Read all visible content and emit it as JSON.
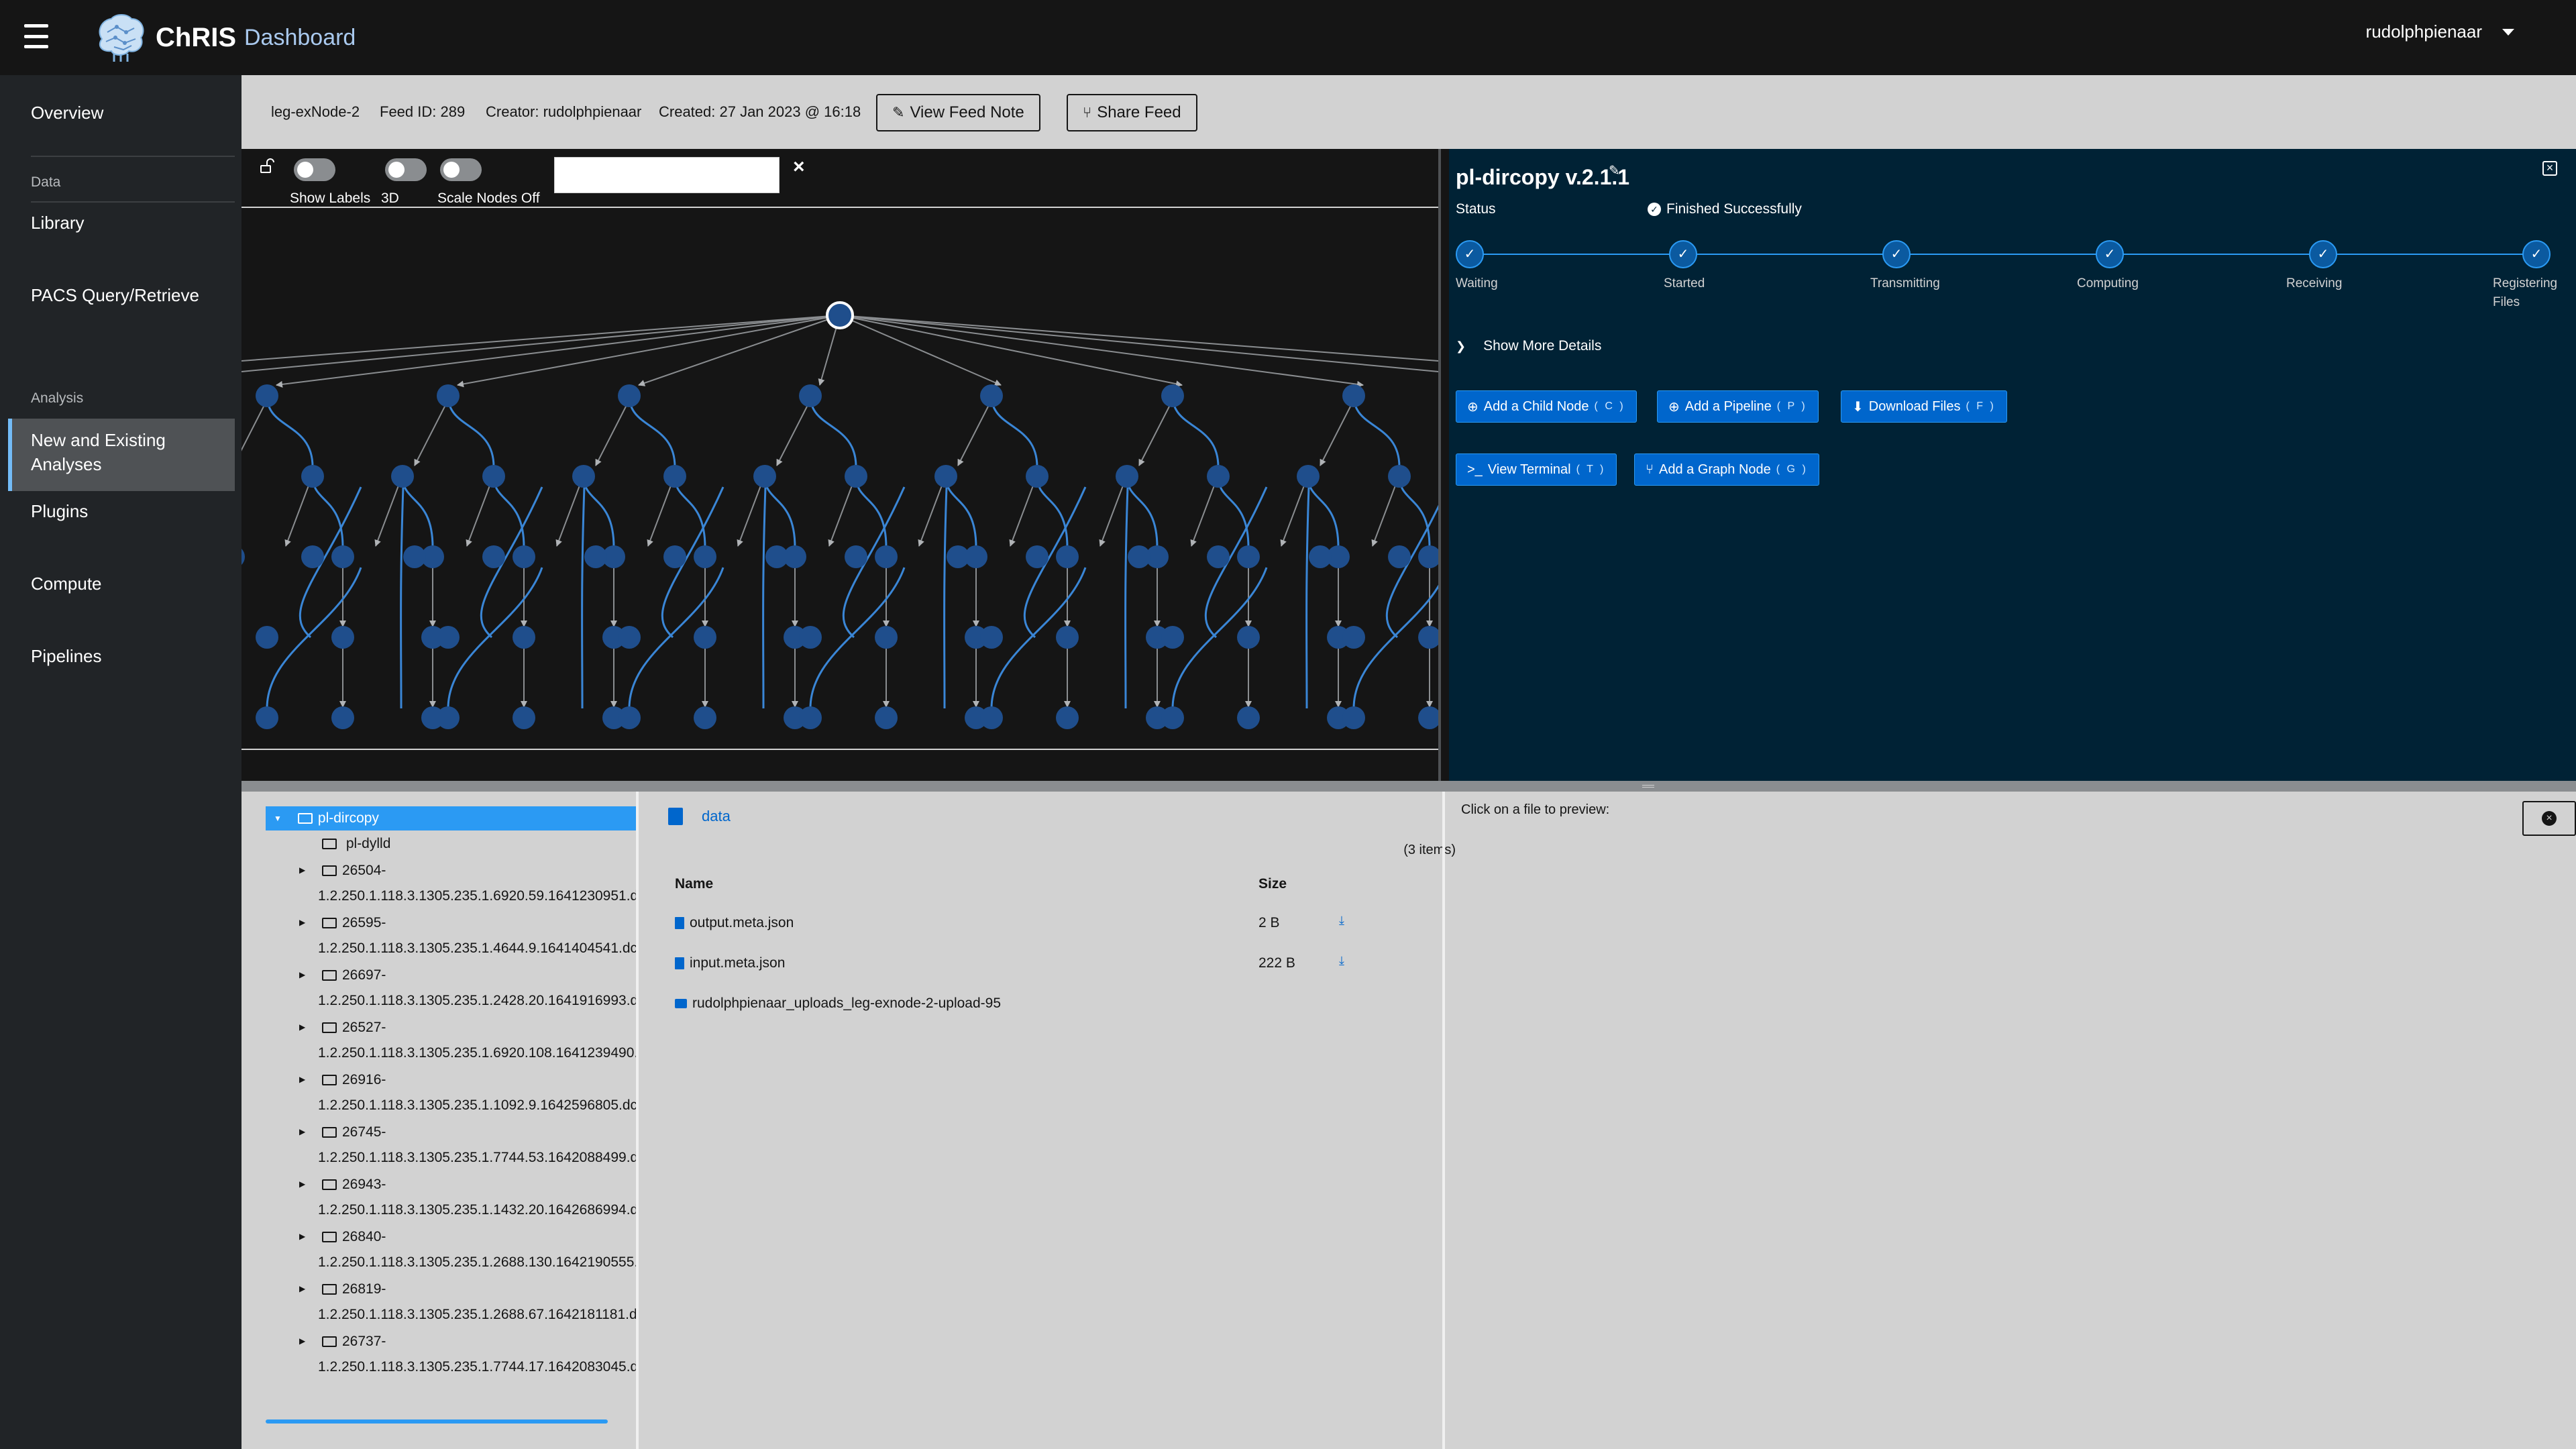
{
  "header": {
    "brand": "ChRIS",
    "product": "Dashboard",
    "username": "rudolphpienaar"
  },
  "sidebar": {
    "overview": "Overview",
    "data_section": "Data",
    "library": "Library",
    "pacs": "PACS Query/Retrieve",
    "analysis_section": "Analysis",
    "analyses_line1": "New and Existing",
    "analyses_line2": "Analyses",
    "plugins": "Plugins",
    "compute": "Compute",
    "pipelines": "Pipelines"
  },
  "feed": {
    "name": "leg-exNode-2",
    "feed_id": "Feed ID: 289",
    "creator": "Creator: rudolphpienaar",
    "created": "Created: 27 Jan 2023 @ 16:18",
    "view_note": "View Feed Note",
    "share": "Share Feed"
  },
  "graph": {
    "show_labels": "Show Labels",
    "three_d": "3D",
    "scale_nodes": "Scale Nodes Off",
    "search_value": "",
    "clear": "×",
    "node_color": "#1f4e8c",
    "edge_color": "#8a8d90",
    "curve_color": "#3a86d6"
  },
  "node_details": {
    "title": "pl-dircopy v.2.1.1",
    "status_label": "Status",
    "status_value": "Finished Successfully",
    "steps": [
      "Waiting",
      "Started",
      "Transmitting",
      "Computing",
      "Receiving",
      "Registering"
    ],
    "last_step_line2": "Files",
    "show_more": "Show More Details",
    "btn_add_child": "Add a Child Node",
    "btn_add_child_key": "( C )",
    "btn_add_pipeline": "Add a Pipeline",
    "btn_add_pipeline_key": "( P )",
    "btn_download": "Download Files",
    "btn_download_key": "( F )",
    "btn_terminal": "View Terminal",
    "btn_terminal_key": "( T )",
    "btn_graph_node": "Add a Graph Node",
    "btn_graph_node_key": "( G )"
  },
  "tree": {
    "root": "pl-dircopy",
    "child_plain": "pl-dylld",
    "items": [
      {
        "id": "26504-",
        "path": "1.2.250.1.118.3.1305.235.1.6920.59.1641230951.d"
      },
      {
        "id": "26595-",
        "path": "1.2.250.1.118.3.1305.235.1.4644.9.1641404541.dc"
      },
      {
        "id": "26697-",
        "path": "1.2.250.1.118.3.1305.235.1.2428.20.1641916993.d"
      },
      {
        "id": "26527-",
        "path": "1.2.250.1.118.3.1305.235.1.6920.108.1641239490."
      },
      {
        "id": "26916-",
        "path": "1.2.250.1.118.3.1305.235.1.1092.9.1642596805.dc"
      },
      {
        "id": "26745-",
        "path": "1.2.250.1.118.3.1305.235.1.7744.53.1642088499.d"
      },
      {
        "id": "26943-",
        "path": "1.2.250.1.118.3.1305.235.1.1432.20.1642686994.d"
      },
      {
        "id": "26840-",
        "path": "1.2.250.1.118.3.1305.235.1.2688.130.1642190555."
      },
      {
        "id": "26819-",
        "path": "1.2.250.1.118.3.1305.235.1.2688.67.1642181181.d"
      },
      {
        "id": "26737-",
        "path": "1.2.250.1.118.3.1305.235.1.7744.17.1642083045.d"
      }
    ]
  },
  "files": {
    "breadcrumb": "data",
    "count": "(3 items)",
    "col_name": "Name",
    "col_size": "Size",
    "rows": [
      {
        "name": "output.meta.json",
        "size": "2 B",
        "type": "file"
      },
      {
        "name": "input.meta.json",
        "size": "222 B",
        "type": "file"
      },
      {
        "name": "rudolphpienaar_uploads_leg-exnode-2-upload-95",
        "size": "",
        "type": "folder"
      }
    ]
  },
  "preview": {
    "hint": "Click on a file to preview:"
  }
}
